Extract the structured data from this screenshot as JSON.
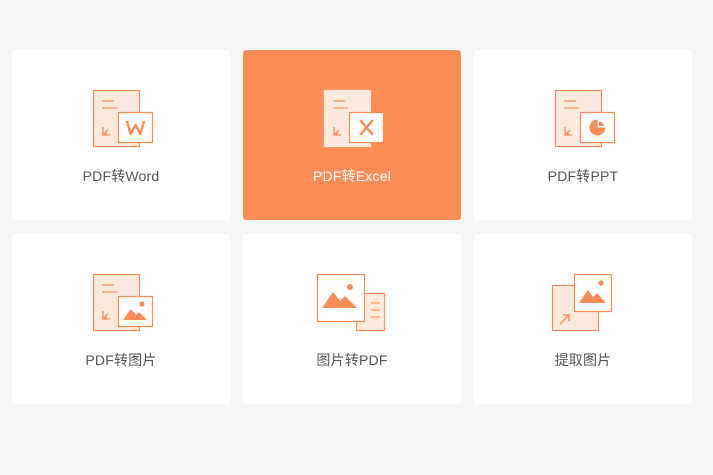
{
  "colors": {
    "accent": "#fb8c55",
    "accent_light": "#fdeadf",
    "tile_bg": "#ffffff",
    "page_bg": "#f6f6f6",
    "label": "#555555"
  },
  "tools": [
    {
      "label": "PDF转Word",
      "icon": "pdf-to-word-icon",
      "active": false
    },
    {
      "label": "PDF转Excel",
      "icon": "pdf-to-excel-icon",
      "active": true
    },
    {
      "label": "PDF转PPT",
      "icon": "pdf-to-ppt-icon",
      "active": false
    },
    {
      "label": "PDF转图片",
      "icon": "pdf-to-image-icon",
      "active": false
    },
    {
      "label": "图片转PDF",
      "icon": "image-to-pdf-icon",
      "active": false
    },
    {
      "label": "提取图片",
      "icon": "extract-image-icon",
      "active": false
    }
  ]
}
